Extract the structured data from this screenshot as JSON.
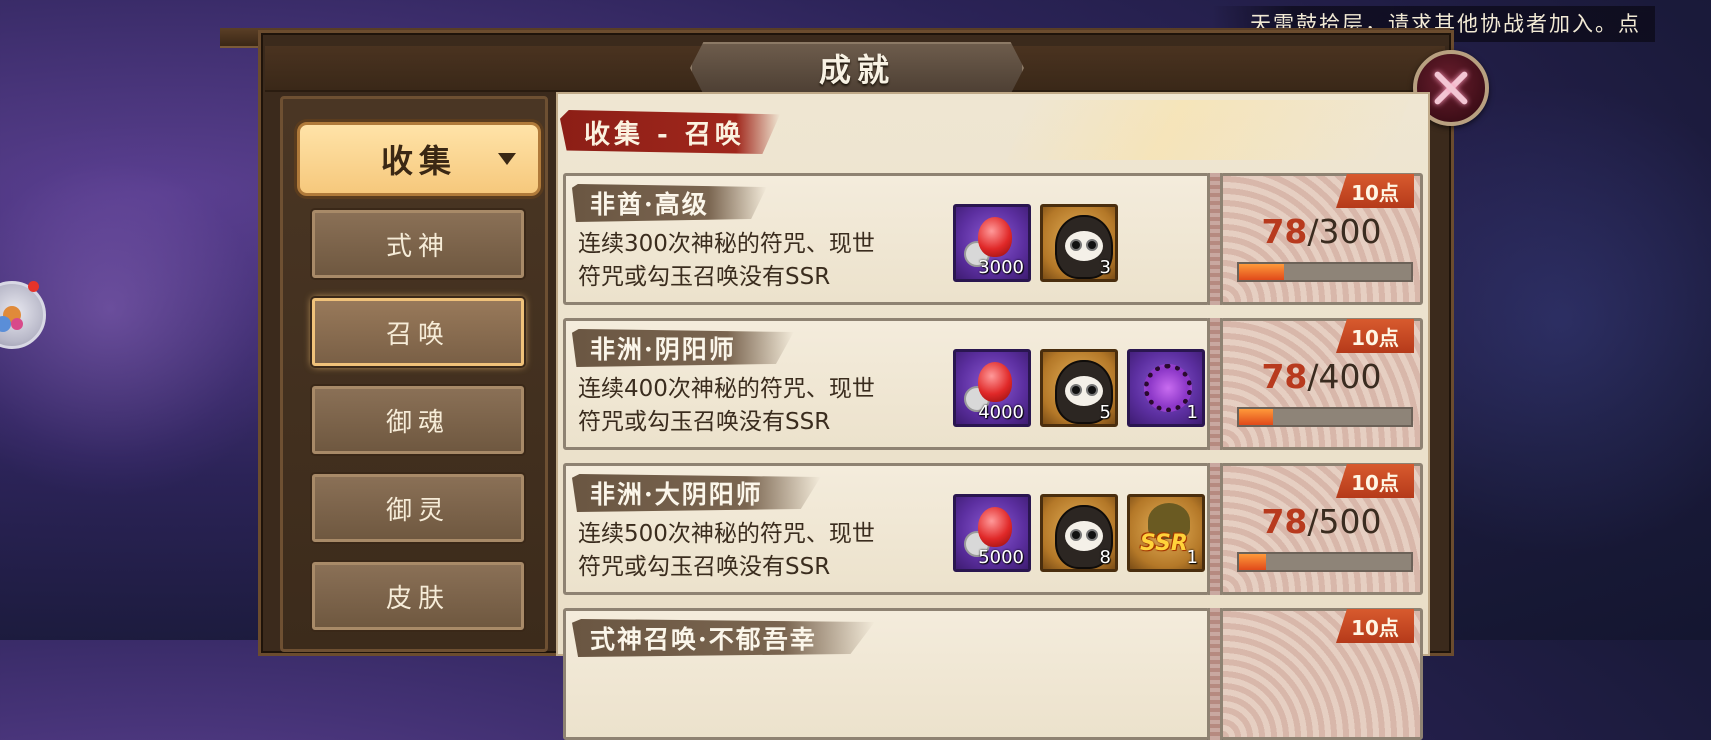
{
  "notice": "天雷鼓拾层，请求其他协战者加入。点",
  "window": {
    "title": "成就"
  },
  "sidebar": {
    "dropdown_label": "收集",
    "items": [
      {
        "label": "式神",
        "active": false
      },
      {
        "label": "召唤",
        "active": true
      },
      {
        "label": "御魂",
        "active": false
      },
      {
        "label": "御灵",
        "active": false
      },
      {
        "label": "皮肤",
        "active": false
      }
    ]
  },
  "section_title": "收集 - 召唤",
  "achievements": [
    {
      "name": "非酋·高级",
      "desc_line1": "连续300次神秘的符咒、现世",
      "desc_line2": "符咒或勾玉召唤没有SSR",
      "rewards": [
        {
          "icon": "jade-orb-icon",
          "count": "3000"
        },
        {
          "icon": "daruma-icon",
          "count": "3"
        }
      ],
      "points": "10点",
      "progress_current": "78",
      "progress_total": "/300",
      "progress_fraction": 0.26
    },
    {
      "name": "非洲·阴阳师",
      "desc_line1": "连续400次神秘的符咒、现世",
      "desc_line2": "符咒或勾玉召唤没有SSR",
      "rewards": [
        {
          "icon": "jade-orb-icon",
          "count": "4000"
        },
        {
          "icon": "daruma-icon",
          "count": "5"
        },
        {
          "icon": "bead-ring-icon",
          "count": "1"
        }
      ],
      "points": "10点",
      "progress_current": "78",
      "progress_total": "/400",
      "progress_fraction": 0.195
    },
    {
      "name": "非洲·大阴阳师",
      "desc_line1": "连续500次神秘的符咒、现世",
      "desc_line2": "符咒或勾玉召唤没有SSR",
      "rewards": [
        {
          "icon": "jade-orb-icon",
          "count": "5000"
        },
        {
          "icon": "daruma-icon",
          "count": "8"
        },
        {
          "icon": "ssr-shikigami-icon",
          "count": "1"
        }
      ],
      "points": "10点",
      "progress_current": "78",
      "progress_total": "/500",
      "progress_fraction": 0.156
    },
    {
      "name": "式神召唤·不郁吾幸",
      "points": "10点"
    }
  ],
  "colors": {
    "accent_orange": "#e04a1a",
    "title_red": "#a0271c",
    "dropdown_gold": "#f6c87c"
  }
}
